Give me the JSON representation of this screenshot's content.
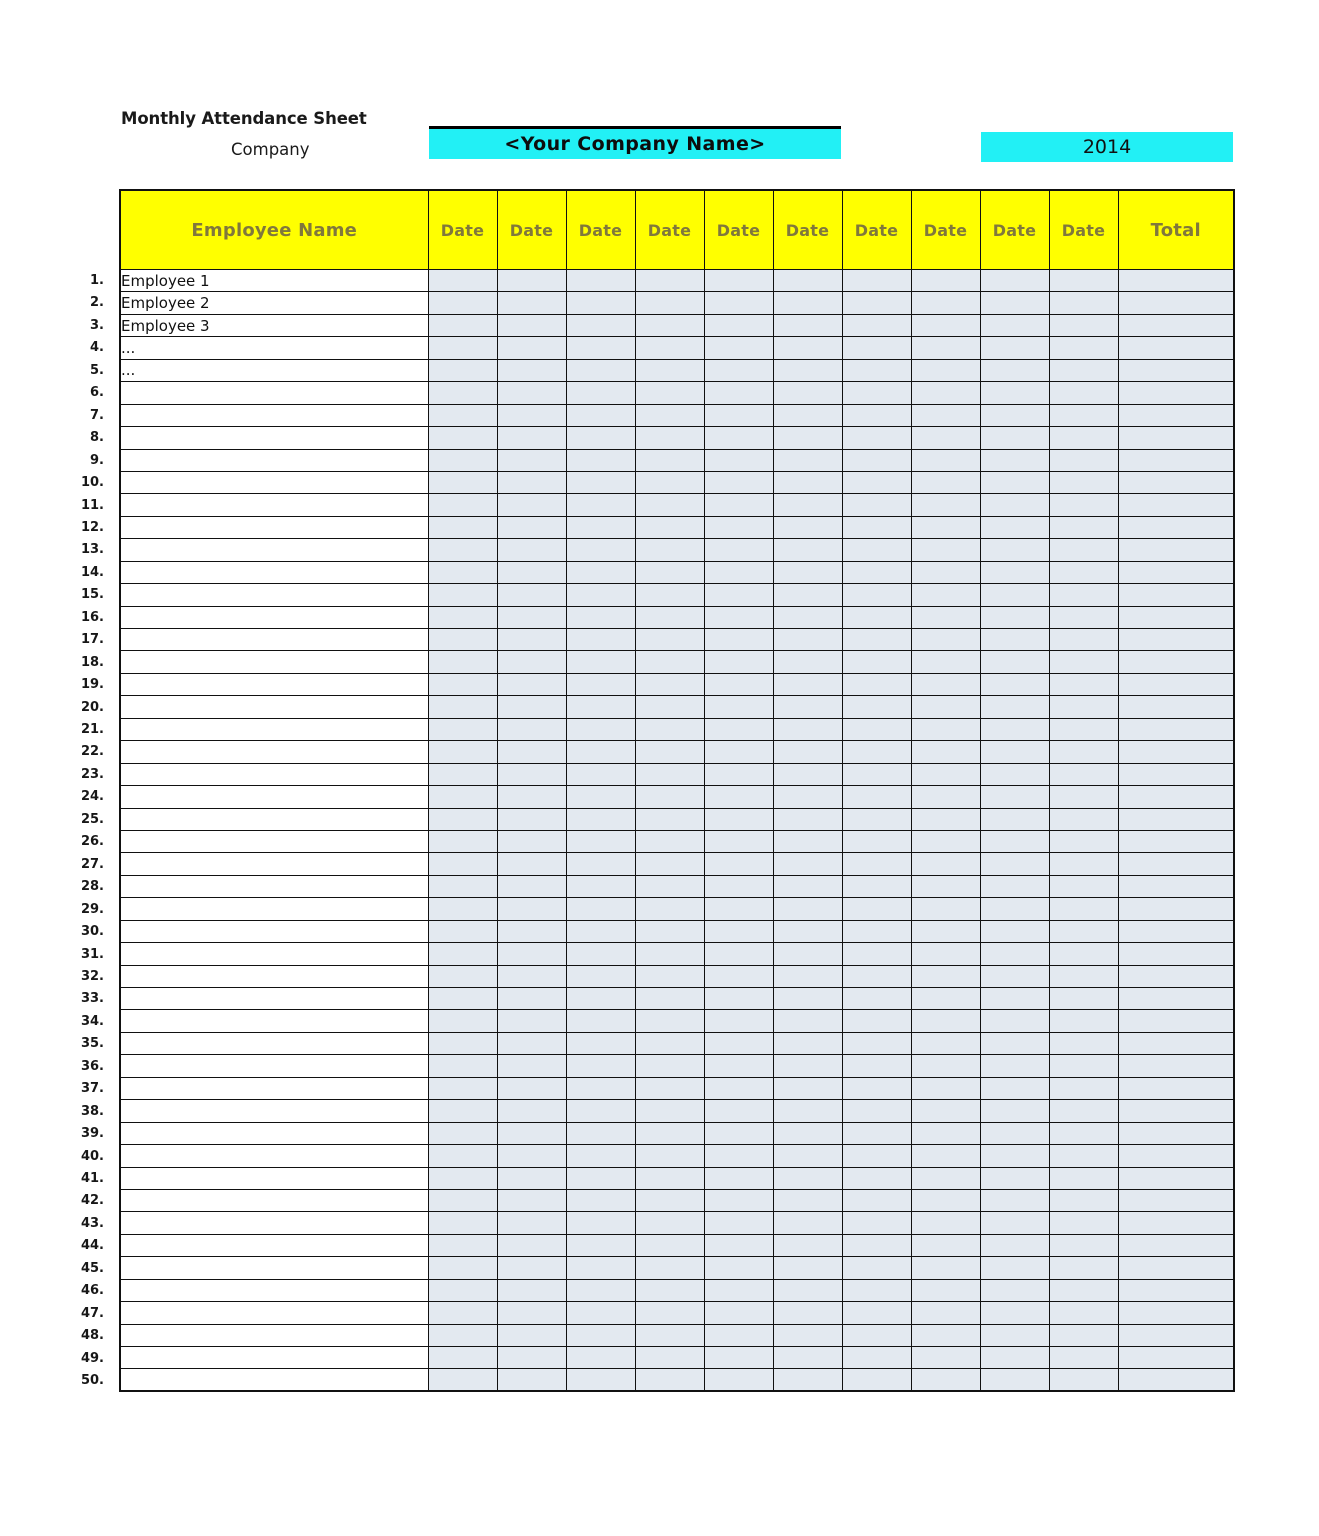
{
  "header": {
    "sheet_title": "Monthly Attendance Sheet",
    "company_label": "Company",
    "company_value": "<Your Company Name>",
    "year_value": "2014",
    "accent_cyan": "#22f0f5",
    "accent_yellow": "#ffff00",
    "header_text_color": "#80783c",
    "cell_fill": "#e3e9f0"
  },
  "table": {
    "columns": [
      {
        "key": "name",
        "label": "Employee Name",
        "type": "name"
      },
      {
        "key": "d1",
        "label": "Date",
        "type": "date"
      },
      {
        "key": "d2",
        "label": "Date",
        "type": "date"
      },
      {
        "key": "d3",
        "label": "Date",
        "type": "date"
      },
      {
        "key": "d4",
        "label": "Date",
        "type": "date"
      },
      {
        "key": "d5",
        "label": "Date",
        "type": "date"
      },
      {
        "key": "d6",
        "label": "Date",
        "type": "date"
      },
      {
        "key": "d7",
        "label": "Date",
        "type": "date"
      },
      {
        "key": "d8",
        "label": "Date",
        "type": "date"
      },
      {
        "key": "d9",
        "label": "Date",
        "type": "date"
      },
      {
        "key": "d10",
        "label": "Date",
        "type": "date"
      },
      {
        "key": "total",
        "label": "Total",
        "type": "total"
      }
    ],
    "date_column_count": 10,
    "row_count": 50,
    "rows": [
      {
        "num": "1.",
        "name": "Employee 1"
      },
      {
        "num": "2.",
        "name": "Employee 2"
      },
      {
        "num": "3.",
        "name": "Employee 3"
      },
      {
        "num": "4.",
        "name": "..."
      },
      {
        "num": "5.",
        "name": "..."
      },
      {
        "num": "6.",
        "name": ""
      },
      {
        "num": "7.",
        "name": ""
      },
      {
        "num": "8.",
        "name": ""
      },
      {
        "num": "9.",
        "name": ""
      },
      {
        "num": "10.",
        "name": ""
      },
      {
        "num": "11.",
        "name": ""
      },
      {
        "num": "12.",
        "name": ""
      },
      {
        "num": "13.",
        "name": ""
      },
      {
        "num": "14.",
        "name": ""
      },
      {
        "num": "15.",
        "name": ""
      },
      {
        "num": "16.",
        "name": ""
      },
      {
        "num": "17.",
        "name": ""
      },
      {
        "num": "18.",
        "name": ""
      },
      {
        "num": "19.",
        "name": ""
      },
      {
        "num": "20.",
        "name": ""
      },
      {
        "num": "21.",
        "name": ""
      },
      {
        "num": "22.",
        "name": ""
      },
      {
        "num": "23.",
        "name": ""
      },
      {
        "num": "24.",
        "name": ""
      },
      {
        "num": "25.",
        "name": ""
      },
      {
        "num": "26.",
        "name": ""
      },
      {
        "num": "27.",
        "name": ""
      },
      {
        "num": "28.",
        "name": ""
      },
      {
        "num": "29.",
        "name": ""
      },
      {
        "num": "30.",
        "name": ""
      },
      {
        "num": "31.",
        "name": ""
      },
      {
        "num": "32.",
        "name": ""
      },
      {
        "num": "33.",
        "name": ""
      },
      {
        "num": "34.",
        "name": ""
      },
      {
        "num": "35.",
        "name": ""
      },
      {
        "num": "36.",
        "name": ""
      },
      {
        "num": "37.",
        "name": ""
      },
      {
        "num": "38.",
        "name": ""
      },
      {
        "num": "39.",
        "name": ""
      },
      {
        "num": "40.",
        "name": ""
      },
      {
        "num": "41.",
        "name": ""
      },
      {
        "num": "42.",
        "name": ""
      },
      {
        "num": "43.",
        "name": ""
      },
      {
        "num": "44.",
        "name": ""
      },
      {
        "num": "45.",
        "name": ""
      },
      {
        "num": "46.",
        "name": ""
      },
      {
        "num": "47.",
        "name": ""
      },
      {
        "num": "48.",
        "name": ""
      },
      {
        "num": "49.",
        "name": ""
      },
      {
        "num": "50.",
        "name": ""
      }
    ]
  }
}
